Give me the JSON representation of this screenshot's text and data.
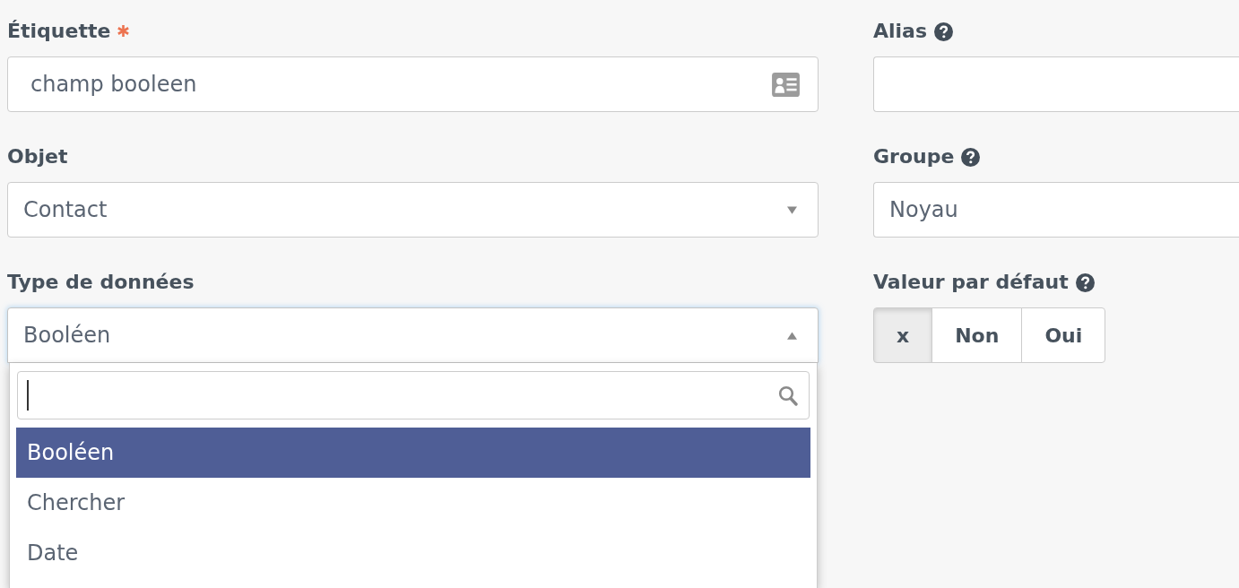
{
  "left_column": [
    {
      "kind": "input_with_icon",
      "label": "Étiquette",
      "required": true,
      "help": false,
      "value": "champ booleen"
    },
    {
      "kind": "select",
      "label": "Objet",
      "required": false,
      "help": false,
      "value": "Contact",
      "expanded": false
    },
    {
      "kind": "select",
      "label": "Type de données",
      "required": false,
      "help": false,
      "value": "Booléen",
      "expanded": true,
      "search": {
        "focused": true
      },
      "options": [
        {
          "label": "Booléen",
          "selected": true
        },
        {
          "label": "Chercher",
          "selected": false
        },
        {
          "label": "Date",
          "selected": false
        }
      ]
    }
  ],
  "right_column": [
    {
      "kind": "input",
      "label": "Alias",
      "required": false,
      "help": true
    },
    {
      "kind": "select",
      "label": "Groupe",
      "required": false,
      "help": true,
      "value": "Noyau"
    },
    {
      "kind": "button_group",
      "label": "Valeur par défaut",
      "required": false,
      "help": true,
      "options": [
        {
          "label": "x",
          "selected": true
        },
        {
          "label": "Non",
          "selected": false
        },
        {
          "label": "Oui",
          "selected": false
        }
      ]
    }
  ]
}
